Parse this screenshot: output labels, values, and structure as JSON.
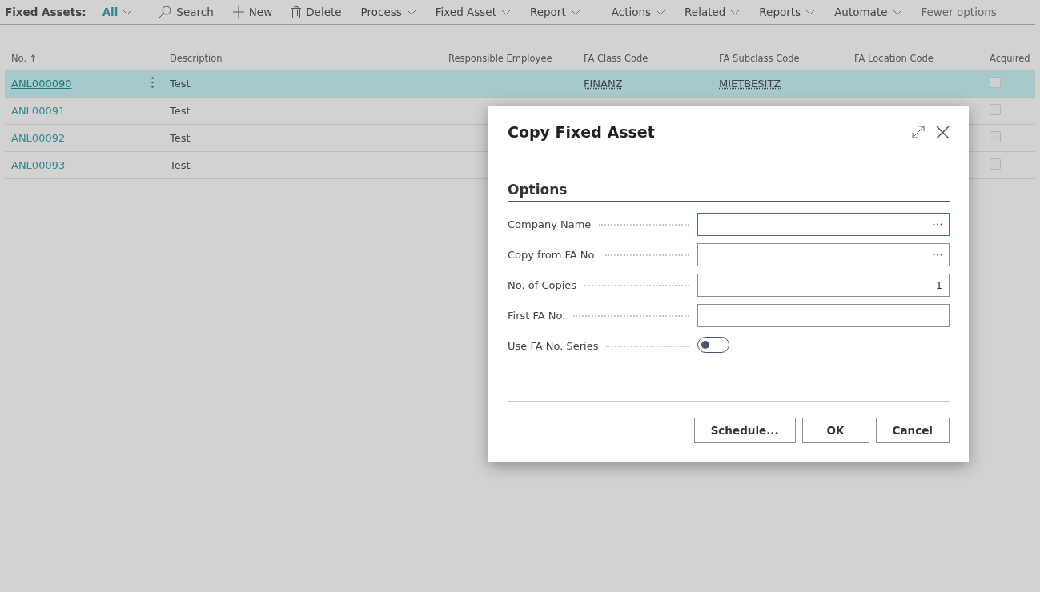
{
  "toolbar": {
    "title": "Fixed Assets:",
    "filter": "All",
    "items": [
      {
        "kind": "separator"
      },
      {
        "kind": "search",
        "label": "Search"
      },
      {
        "kind": "new",
        "label": "New"
      },
      {
        "kind": "delete",
        "label": "Delete"
      },
      {
        "kind": "menu",
        "label": "Process"
      },
      {
        "kind": "menu",
        "label": "Fixed Asset"
      },
      {
        "kind": "menu",
        "label": "Report"
      },
      {
        "kind": "separator"
      },
      {
        "kind": "menu",
        "label": "Actions"
      },
      {
        "kind": "menu",
        "label": "Related"
      },
      {
        "kind": "menu",
        "label": "Reports"
      },
      {
        "kind": "menu",
        "label": "Automate"
      },
      {
        "kind": "link",
        "label": "Fewer options"
      }
    ]
  },
  "table": {
    "columns": [
      "No. ↑",
      "Description",
      "Responsible Employee",
      "FA Class Code",
      "FA Subclass Code",
      "FA Location Code",
      "Acquired"
    ],
    "rows": [
      {
        "no": "ANL000090",
        "description": "Test",
        "class_code": "FINANZ",
        "subclass_code": "MIETBESITZ",
        "acquired": false,
        "selected": true
      },
      {
        "no": "ANL00091",
        "description": "Test",
        "acquired": false,
        "selected": false
      },
      {
        "no": "ANL00092",
        "description": "Test",
        "acquired": false,
        "selected": false
      },
      {
        "no": "ANL00093",
        "description": "Test",
        "acquired": false,
        "selected": false
      }
    ]
  },
  "dialog": {
    "title": "Copy Fixed Asset",
    "section": "Options",
    "fields": [
      {
        "kind": "lookup",
        "label": "Company Name",
        "focused": true
      },
      {
        "kind": "lookup",
        "label": "Copy from FA No.",
        "focused": false
      },
      {
        "kind": "number",
        "label": "No. of Copies",
        "value": "1",
        "focused": false
      },
      {
        "kind": "text",
        "label": "First FA No.",
        "focused": false
      },
      {
        "kind": "toggle",
        "label": "Use FA No. Series",
        "on": false
      }
    ],
    "buttons": [
      "Schedule...",
      "OK",
      "Cancel"
    ]
  }
}
